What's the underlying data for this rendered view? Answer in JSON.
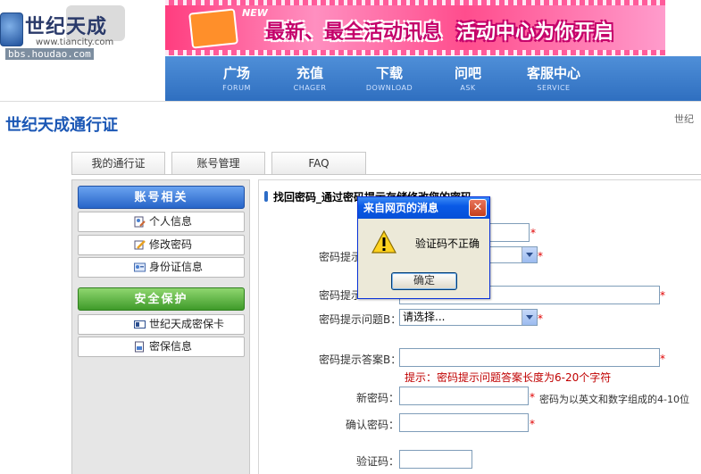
{
  "header": {
    "logo_title": "世纪天成",
    "logo_url1": "www.tiancity.com",
    "logo_url2": "bbs.houdao.com",
    "banner_new": "NEW",
    "banner_text1": "最新、最全活动讯息",
    "banner_text2": "活动中心为你开启"
  },
  "nav": [
    {
      "cn": "广场",
      "en": "FORUM"
    },
    {
      "cn": "充值",
      "en": "CHAGER"
    },
    {
      "cn": "下载",
      "en": "DOWNLOAD"
    },
    {
      "cn": "问吧",
      "en": "ASK"
    },
    {
      "cn": "客服中心",
      "en": "SERVICE"
    }
  ],
  "page": {
    "title": "世纪天成通行证",
    "crumb": "世纪"
  },
  "tabs": [
    "我的通行证",
    "账号管理",
    "FAQ"
  ],
  "sidebar": {
    "section1": "账号相关",
    "items1": [
      "个人信息",
      "修改密码",
      "身份证信息"
    ],
    "section2": "安全保护",
    "items2": [
      "世纪天成密保卡",
      "密保信息"
    ]
  },
  "main": {
    "heading": "找回密码_通过密码提示存储修改您的密码",
    "q_label_a": "密码提示",
    "a_label_a": "密码提示",
    "q_label_b": "密码提示问题B：",
    "select_value": "请选择...",
    "a_label_b": "密码提示答案B：",
    "answer_hint": "提示：密码提示问题答案长度为6-20个字符",
    "new_pwd_label": "新密码：",
    "new_pwd_hint": "密码为以英文和数字组成的4-10位",
    "confirm_label": "确认密码：",
    "captcha_label": "验证码："
  },
  "dialog": {
    "title": "来自网页的消息",
    "message": "验证码不正确",
    "ok": "确定",
    "close": "✕"
  }
}
